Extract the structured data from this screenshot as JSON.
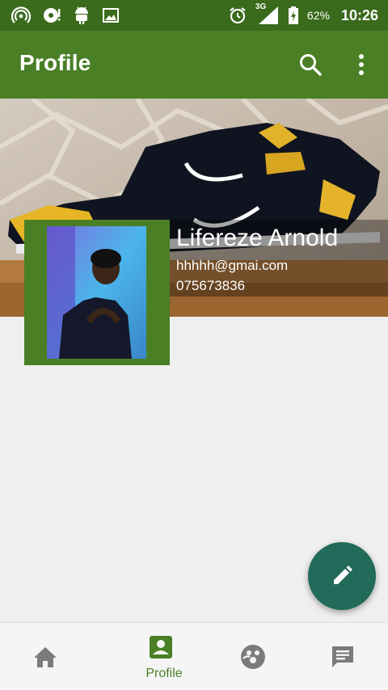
{
  "status_bar": {
    "network": "3G",
    "battery": "62%",
    "time": "10:26"
  },
  "app_bar": {
    "title": "Profile"
  },
  "profile": {
    "name": "Lifereze Arnold",
    "email": "hhhhh@gmai.com",
    "phone": "075673836"
  },
  "bottom_nav": {
    "items": [
      {
        "icon": "home-icon",
        "label": ""
      },
      {
        "icon": "account-box-icon",
        "label": "Profile"
      },
      {
        "icon": "group-icon",
        "label": ""
      },
      {
        "icon": "chat-icon",
        "label": ""
      }
    ],
    "active_index": 1
  },
  "colors": {
    "status_bar": "#3a6a1c",
    "app_bar": "#4a7f26",
    "accent_fab": "#226a5a",
    "background": "#efefef",
    "nav_inactive": "#8a8a8a"
  }
}
